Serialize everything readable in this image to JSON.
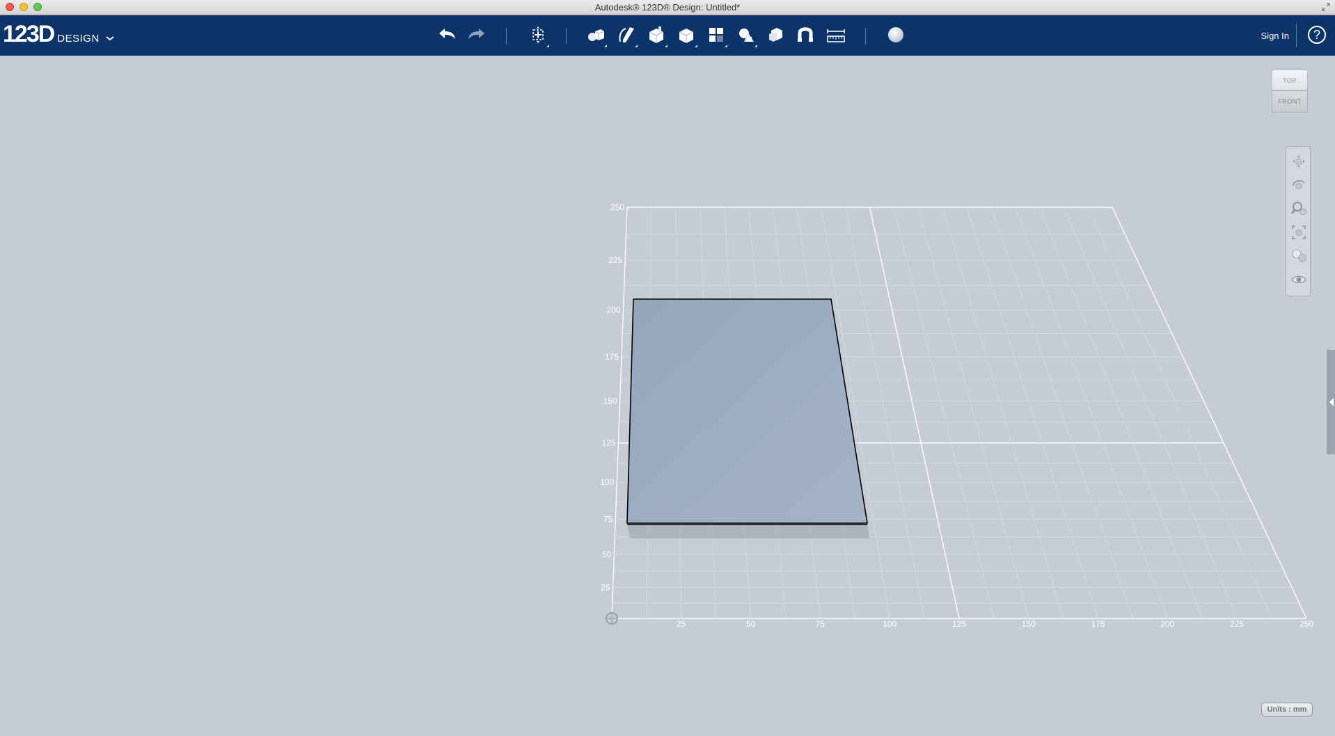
{
  "window": {
    "title": "Autodesk® 123D® Design: Untitled*"
  },
  "toolbar": {
    "logo_number": "123D",
    "logo_word": "DESIGN",
    "buttons": [
      {
        "name": "undo-icon"
      },
      {
        "name": "redo-icon"
      },
      {
        "name": "transform-icon"
      },
      {
        "name": "primitives-icon"
      },
      {
        "name": "sketch-icon"
      },
      {
        "name": "construct-icon"
      },
      {
        "name": "modify-icon"
      },
      {
        "name": "pattern-icon"
      },
      {
        "name": "grouping-icon"
      },
      {
        "name": "combine-icon"
      },
      {
        "name": "snap-icon"
      },
      {
        "name": "measure-icon"
      },
      {
        "name": "material-icon"
      }
    ],
    "sign_in": "Sign In",
    "help": "?"
  },
  "viewcube": {
    "top_label": "TOP",
    "front_label": "FRONT"
  },
  "navbar": {
    "items": [
      "pan-icon",
      "orbit-icon",
      "zoom-icon",
      "fit-icon",
      "visual-style-icon",
      "visibility-icon"
    ]
  },
  "grid": {
    "x_ticks": [
      "25",
      "50",
      "75",
      "100",
      "125",
      "150",
      "175",
      "200",
      "225",
      "250"
    ],
    "y_ticks": [
      "25",
      "50",
      "75",
      "100",
      "125",
      "150",
      "175",
      "200",
      "225",
      "250"
    ]
  },
  "units": {
    "label": "Units : mm"
  },
  "colors": {
    "toolbar_bg": "#0c3468",
    "viewport_bg": "#c5ccd6",
    "box_face": "#9dacc0"
  }
}
